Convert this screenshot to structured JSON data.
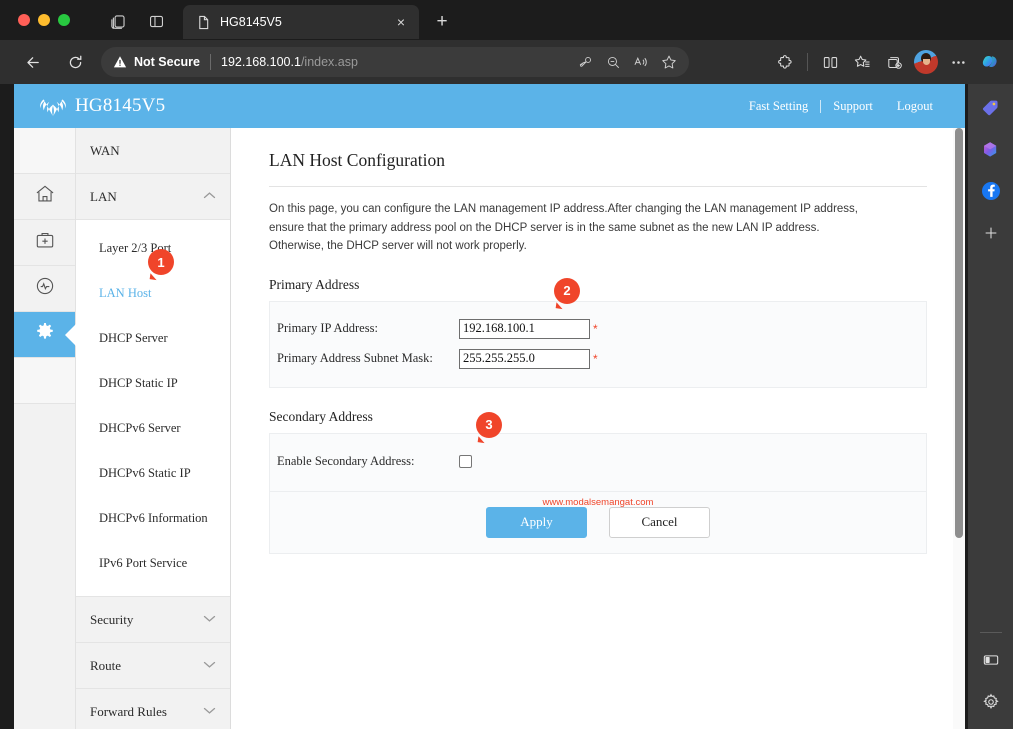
{
  "browser": {
    "window_controls": [
      "close",
      "minimize",
      "maximize"
    ],
    "tab_icons": [
      {
        "name": "vertical-tabs-icon",
        "label": "Vertical tabs"
      },
      {
        "name": "workspaces-icon",
        "label": "Workspaces"
      }
    ],
    "tab": {
      "title": "HG8145V5",
      "favicon": "page-icon",
      "close_label": "×"
    },
    "new_tab_label": "+",
    "nav": {
      "back_label": "←",
      "reload_label": "↻",
      "security_text": "Not Secure",
      "url_host": "192.168.100.1",
      "url_path": "/index.asp",
      "omni_actions": [
        "password-key-icon",
        "zoom-out-icon",
        "read-aloud-icon",
        "favorite-star-icon"
      ],
      "right_actions": [
        "extensions-puzzle-icon",
        "split-screen-icon",
        "favorites-list-icon",
        "collections-icon",
        "profile-avatar",
        "settings-more-icon",
        "copilot-icon"
      ]
    }
  },
  "edge_sidebar": {
    "items": [
      {
        "name": "shopping-tag-icon",
        "label": "Shopping"
      },
      {
        "name": "copilot-office-icon",
        "label": "Microsoft 365"
      },
      {
        "name": "facebook-icon",
        "label": "Facebook"
      },
      {
        "name": "add-sidebar-app-icon",
        "label": "+"
      }
    ],
    "bottom": [
      {
        "name": "sidebar-panel-toggle-icon",
        "label": "Toggle sidebar"
      },
      {
        "name": "sidebar-settings-gear-icon",
        "label": "Sidebar settings"
      }
    ]
  },
  "router": {
    "brand": "HG8145V5",
    "header_links": {
      "fast_setting": "Fast Setting",
      "support": "Support",
      "logout": "Logout"
    },
    "rail": [
      {
        "name": "sidebar-rail-home",
        "icon": "home-icon",
        "active": false
      },
      {
        "name": "sidebar-rail-service",
        "icon": "toolkit-plus-icon",
        "active": false
      },
      {
        "name": "sidebar-rail-status",
        "icon": "status-pulse-icon",
        "active": false
      },
      {
        "name": "sidebar-rail-advanced",
        "icon": "gear-icon",
        "active": true
      }
    ],
    "menu": {
      "wan": "WAN",
      "lan": "LAN",
      "lan_items": [
        "Layer 2/3 Port",
        "LAN Host",
        "DHCP Server",
        "DHCP Static IP",
        "DHCPv6 Server",
        "DHCPv6 Static IP",
        "DHCPv6 Information",
        "IPv6 Port Service"
      ],
      "active_item": "LAN Host",
      "security": "Security",
      "route": "Route",
      "forward_rules": "Forward Rules",
      "chevron_up": "⌃",
      "chevron_down": "⌄"
    },
    "content": {
      "title": "LAN Host Configuration",
      "description": "On this page, you can configure the LAN management IP address.After changing the LAN management IP address, ensure that the primary address pool on the DHCP server is in the same subnet as the new LAN IP address. Otherwise, the DHCP server will not work properly.",
      "primary_section": "Primary Address",
      "fields": [
        {
          "label": "Primary IP Address:",
          "value": "192.168.100.1",
          "required": "*"
        },
        {
          "label": "Primary Address Subnet Mask:",
          "value": "255.255.255.0",
          "required": "*"
        }
      ],
      "secondary_section": "Secondary Address",
      "secondary_checkbox_label": "Enable Secondary Address:",
      "secondary_checked": false,
      "watermark": "www.modalsemangat.com",
      "apply_label": "Apply",
      "cancel_label": "Cancel"
    },
    "badges": [
      {
        "number": "1",
        "target": "lan-host-menu-item"
      },
      {
        "number": "2",
        "target": "primary-ip-address-field"
      },
      {
        "number": "3",
        "target": "enable-secondary-address-checkbox"
      }
    ]
  },
  "colors": {
    "brand_blue": "#5bb3e8",
    "badge_orange": "#f0452a",
    "chrome_dark": "#2f2f2f",
    "required_red": "#f0452a"
  }
}
